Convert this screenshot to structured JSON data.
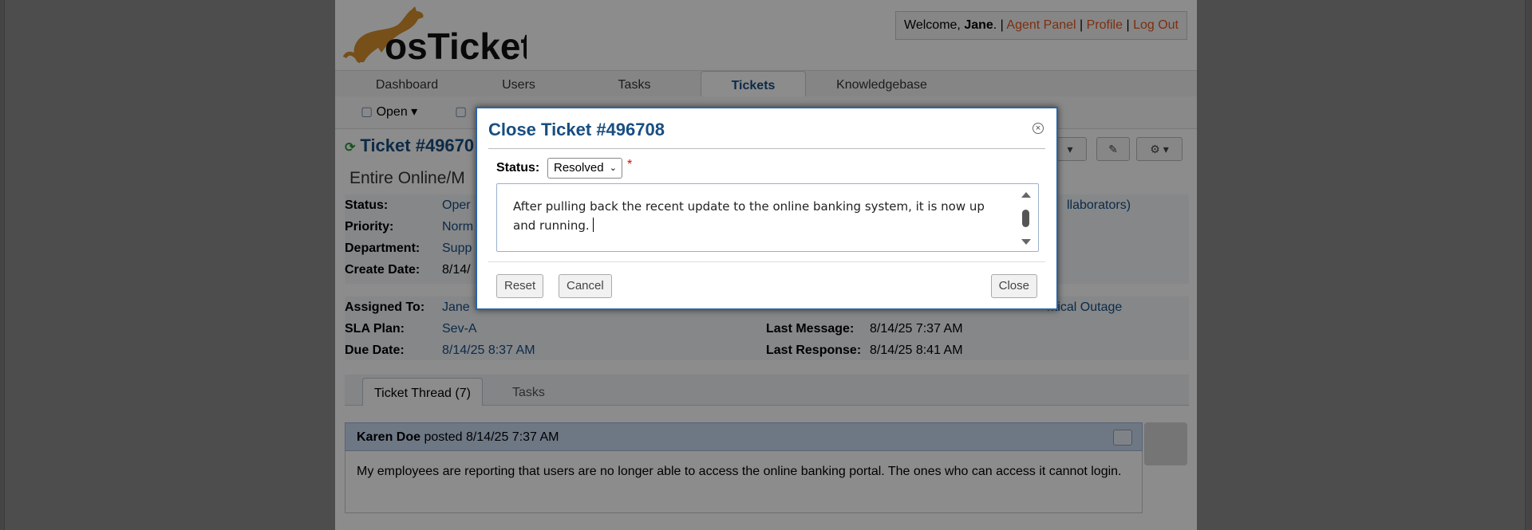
{
  "header": {
    "logo_text": "osTicket",
    "welcome_prefix": "Welcome, ",
    "user_name": "Jane",
    "agent_panel_label": "Agent Panel",
    "profile_label": "Profile",
    "logout_label": "Log Out",
    "sep": "|"
  },
  "nav": {
    "tabs": [
      "Dashboard",
      "Users",
      "Tasks",
      "Tickets",
      "Knowledgebase"
    ],
    "active": "Tickets"
  },
  "subnav": {
    "open_label": "Open"
  },
  "ticket": {
    "title": "Ticket #49670",
    "subject": "Entire Online/M",
    "fields_left": [
      {
        "label": "Status:",
        "value": "Oper"
      },
      {
        "label": "Priority:",
        "value": "Norm"
      },
      {
        "label": "Department:",
        "value": "Supp"
      },
      {
        "label": "Create Date:",
        "value": "8/14/"
      }
    ],
    "right_tail": "llaborators)",
    "assigned_label": "Assigned To:",
    "assigned_value": "Jane",
    "sla_label": "SLA Plan:",
    "sla_value": "Sev-A",
    "due_label": "Due Date:",
    "due_value": "8/14/25 8:37 AM",
    "help_topic_tail": "ritical Outage",
    "last_message_label": "Last Message:",
    "last_message_value": "8/14/25 7:37 AM",
    "last_response_label": "Last Response:",
    "last_response_value": "8/14/25 8:41 AM"
  },
  "thread": {
    "tabs": [
      "Ticket Thread (7)",
      "Tasks"
    ],
    "author": "Karen Doe",
    "posted_text": " posted 8/14/25 7:37 AM",
    "body": "My employees are reporting that users are no longer able to access the online banking portal. The ones who can access it cannot login."
  },
  "modal": {
    "title": "Close Ticket #496708",
    "status_label": "Status:",
    "status_value": "Resolved",
    "required_mark": "*",
    "note_text": "After pulling back the recent update to the online banking system, it is now up and running.",
    "reset_label": "Reset",
    "cancel_label": "Cancel",
    "close_label": "Close"
  },
  "colors": {
    "link_blue": "#184e81",
    "header_link": "#e2561f",
    "modal_border": "#2a64a8"
  }
}
